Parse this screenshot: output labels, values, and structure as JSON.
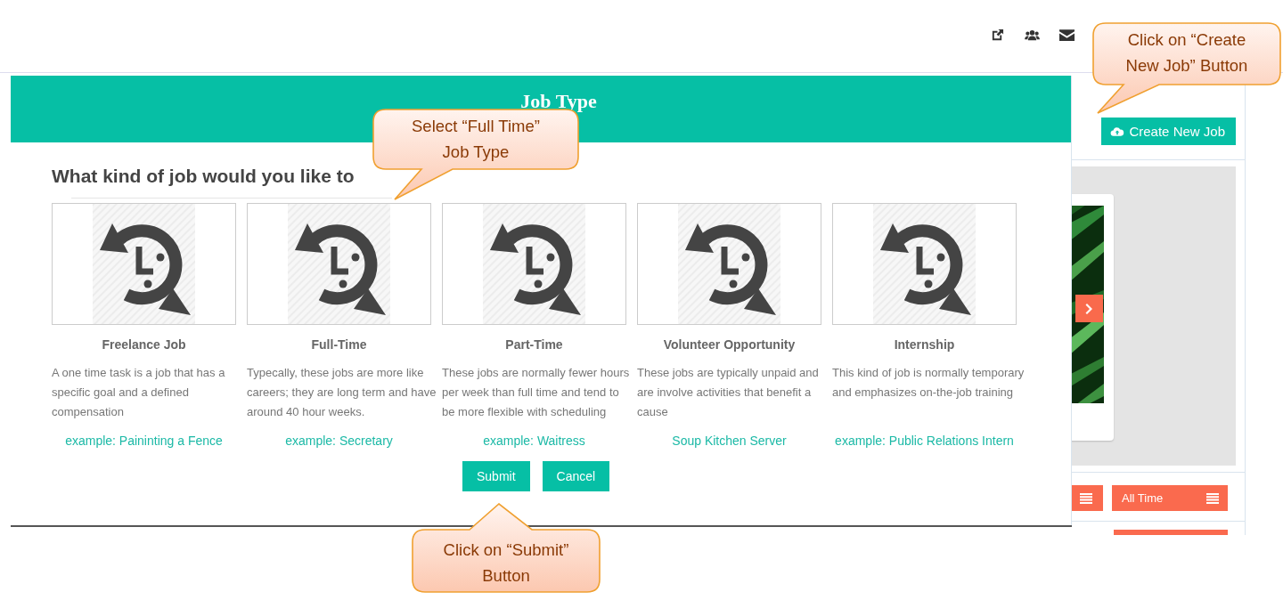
{
  "toolbar": {
    "create_button": "Create New Job"
  },
  "filters": [
    {
      "label": "All Time"
    }
  ],
  "modal": {
    "title": "Job Type",
    "question": "What kind of job would you like to",
    "job_types": [
      {
        "title": "Freelance Job",
        "description": "A one time task is a job that has a specific goal and a defined compensation",
        "example": "example: Paininting a Fence"
      },
      {
        "title": "Full-Time",
        "description": "Typecally, these jobs are more like careers; they are long term and have around 40 hour weeks.",
        "example": "example: Secretary"
      },
      {
        "title": "Part-Time",
        "description": "These jobs are normally fewer hours per week than full time and tend to be more flexible with scheduling",
        "example": "example: Waitress"
      },
      {
        "title": "Volunteer Opportunity",
        "description": "These jobs are typically unpaid and are involve activities that benefit a cause",
        "example": "Soup Kitchen Server"
      },
      {
        "title": "Internship",
        "description": "This kind of job is normally temporary and emphasizes on-the-job training",
        "example": "example: Public Relations Intern"
      }
    ],
    "buttons": [
      "Submit",
      "Cancel"
    ]
  },
  "callouts": [
    {
      "text": "Select “Full Time”\nJob Type",
      "kind": "down"
    },
    {
      "text": "Click on “Create\nNew Job” Button",
      "kind": "down"
    },
    {
      "text": "Click on “Submit”\nButton",
      "kind": "up"
    }
  ]
}
